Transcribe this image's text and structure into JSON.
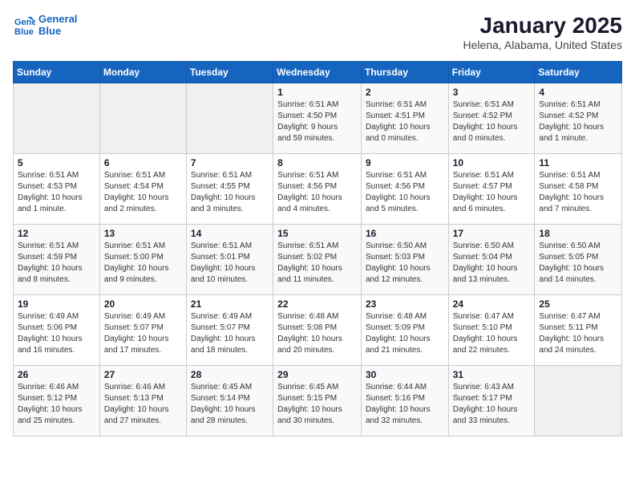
{
  "header": {
    "logo_general": "General",
    "logo_blue": "Blue",
    "title": "January 2025",
    "subtitle": "Helena, Alabama, United States"
  },
  "weekdays": [
    "Sunday",
    "Monday",
    "Tuesday",
    "Wednesday",
    "Thursday",
    "Friday",
    "Saturday"
  ],
  "weeks": [
    [
      {
        "day": "",
        "info": ""
      },
      {
        "day": "",
        "info": ""
      },
      {
        "day": "",
        "info": ""
      },
      {
        "day": "1",
        "info": "Sunrise: 6:51 AM\nSunset: 4:50 PM\nDaylight: 9 hours\nand 59 minutes."
      },
      {
        "day": "2",
        "info": "Sunrise: 6:51 AM\nSunset: 4:51 PM\nDaylight: 10 hours\nand 0 minutes."
      },
      {
        "day": "3",
        "info": "Sunrise: 6:51 AM\nSunset: 4:52 PM\nDaylight: 10 hours\nand 0 minutes."
      },
      {
        "day": "4",
        "info": "Sunrise: 6:51 AM\nSunset: 4:52 PM\nDaylight: 10 hours\nand 1 minute."
      }
    ],
    [
      {
        "day": "5",
        "info": "Sunrise: 6:51 AM\nSunset: 4:53 PM\nDaylight: 10 hours\nand 1 minute."
      },
      {
        "day": "6",
        "info": "Sunrise: 6:51 AM\nSunset: 4:54 PM\nDaylight: 10 hours\nand 2 minutes."
      },
      {
        "day": "7",
        "info": "Sunrise: 6:51 AM\nSunset: 4:55 PM\nDaylight: 10 hours\nand 3 minutes."
      },
      {
        "day": "8",
        "info": "Sunrise: 6:51 AM\nSunset: 4:56 PM\nDaylight: 10 hours\nand 4 minutes."
      },
      {
        "day": "9",
        "info": "Sunrise: 6:51 AM\nSunset: 4:56 PM\nDaylight: 10 hours\nand 5 minutes."
      },
      {
        "day": "10",
        "info": "Sunrise: 6:51 AM\nSunset: 4:57 PM\nDaylight: 10 hours\nand 6 minutes."
      },
      {
        "day": "11",
        "info": "Sunrise: 6:51 AM\nSunset: 4:58 PM\nDaylight: 10 hours\nand 7 minutes."
      }
    ],
    [
      {
        "day": "12",
        "info": "Sunrise: 6:51 AM\nSunset: 4:59 PM\nDaylight: 10 hours\nand 8 minutes."
      },
      {
        "day": "13",
        "info": "Sunrise: 6:51 AM\nSunset: 5:00 PM\nDaylight: 10 hours\nand 9 minutes."
      },
      {
        "day": "14",
        "info": "Sunrise: 6:51 AM\nSunset: 5:01 PM\nDaylight: 10 hours\nand 10 minutes."
      },
      {
        "day": "15",
        "info": "Sunrise: 6:51 AM\nSunset: 5:02 PM\nDaylight: 10 hours\nand 11 minutes."
      },
      {
        "day": "16",
        "info": "Sunrise: 6:50 AM\nSunset: 5:03 PM\nDaylight: 10 hours\nand 12 minutes."
      },
      {
        "day": "17",
        "info": "Sunrise: 6:50 AM\nSunset: 5:04 PM\nDaylight: 10 hours\nand 13 minutes."
      },
      {
        "day": "18",
        "info": "Sunrise: 6:50 AM\nSunset: 5:05 PM\nDaylight: 10 hours\nand 14 minutes."
      }
    ],
    [
      {
        "day": "19",
        "info": "Sunrise: 6:49 AM\nSunset: 5:06 PM\nDaylight: 10 hours\nand 16 minutes."
      },
      {
        "day": "20",
        "info": "Sunrise: 6:49 AM\nSunset: 5:07 PM\nDaylight: 10 hours\nand 17 minutes."
      },
      {
        "day": "21",
        "info": "Sunrise: 6:49 AM\nSunset: 5:07 PM\nDaylight: 10 hours\nand 18 minutes."
      },
      {
        "day": "22",
        "info": "Sunrise: 6:48 AM\nSunset: 5:08 PM\nDaylight: 10 hours\nand 20 minutes."
      },
      {
        "day": "23",
        "info": "Sunrise: 6:48 AM\nSunset: 5:09 PM\nDaylight: 10 hours\nand 21 minutes."
      },
      {
        "day": "24",
        "info": "Sunrise: 6:47 AM\nSunset: 5:10 PM\nDaylight: 10 hours\nand 22 minutes."
      },
      {
        "day": "25",
        "info": "Sunrise: 6:47 AM\nSunset: 5:11 PM\nDaylight: 10 hours\nand 24 minutes."
      }
    ],
    [
      {
        "day": "26",
        "info": "Sunrise: 6:46 AM\nSunset: 5:12 PM\nDaylight: 10 hours\nand 25 minutes."
      },
      {
        "day": "27",
        "info": "Sunrise: 6:46 AM\nSunset: 5:13 PM\nDaylight: 10 hours\nand 27 minutes."
      },
      {
        "day": "28",
        "info": "Sunrise: 6:45 AM\nSunset: 5:14 PM\nDaylight: 10 hours\nand 28 minutes."
      },
      {
        "day": "29",
        "info": "Sunrise: 6:45 AM\nSunset: 5:15 PM\nDaylight: 10 hours\nand 30 minutes."
      },
      {
        "day": "30",
        "info": "Sunrise: 6:44 AM\nSunset: 5:16 PM\nDaylight: 10 hours\nand 32 minutes."
      },
      {
        "day": "31",
        "info": "Sunrise: 6:43 AM\nSunset: 5:17 PM\nDaylight: 10 hours\nand 33 minutes."
      },
      {
        "day": "",
        "info": ""
      }
    ]
  ]
}
